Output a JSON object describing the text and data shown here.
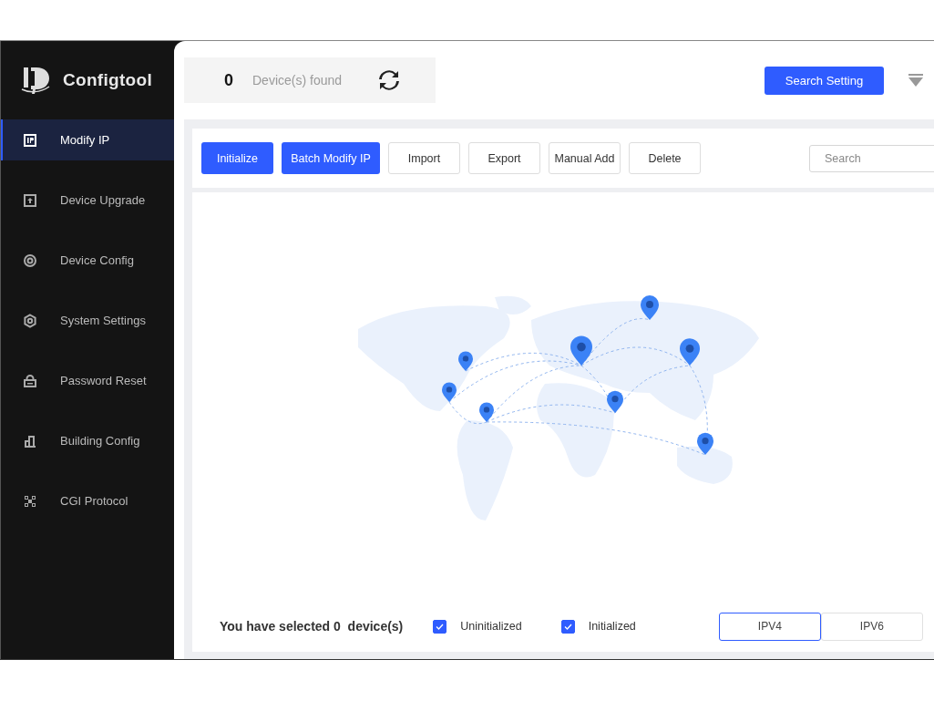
{
  "app": {
    "name": "Configtool"
  },
  "sidebar": {
    "items": [
      {
        "label": "Modify IP",
        "selected": true
      },
      {
        "label": "Device Upgrade",
        "selected": false
      },
      {
        "label": "Device Config",
        "selected": false
      },
      {
        "label": "System Settings",
        "selected": false
      },
      {
        "label": "Password Reset",
        "selected": false
      },
      {
        "label": "Building Config",
        "selected": false
      },
      {
        "label": "CGI Protocol",
        "selected": false
      }
    ]
  },
  "header": {
    "device_count": "0",
    "device_label": "Device(s) found",
    "search_setting_button": "Search Setting"
  },
  "toolbar": {
    "buttons": [
      {
        "label": "Initialize",
        "kind": "primary"
      },
      {
        "label": "Batch Modify IP",
        "kind": "primary"
      },
      {
        "label": "Import",
        "kind": "plain"
      },
      {
        "label": "Export",
        "kind": "plain"
      },
      {
        "label": "Manual Add",
        "kind": "plain"
      },
      {
        "label": "Delete",
        "kind": "plain"
      }
    ],
    "search": {
      "placeholder": "Search"
    }
  },
  "footer": {
    "selection_text": "You have selected 0  device(s)",
    "filters": [
      {
        "label": "Uninitialized",
        "checked": true
      },
      {
        "label": "Initialized",
        "checked": true
      }
    ],
    "ip_tabs": [
      {
        "label": "IPV4",
        "selected": true
      },
      {
        "label": "IPV6",
        "selected": false
      }
    ]
  }
}
